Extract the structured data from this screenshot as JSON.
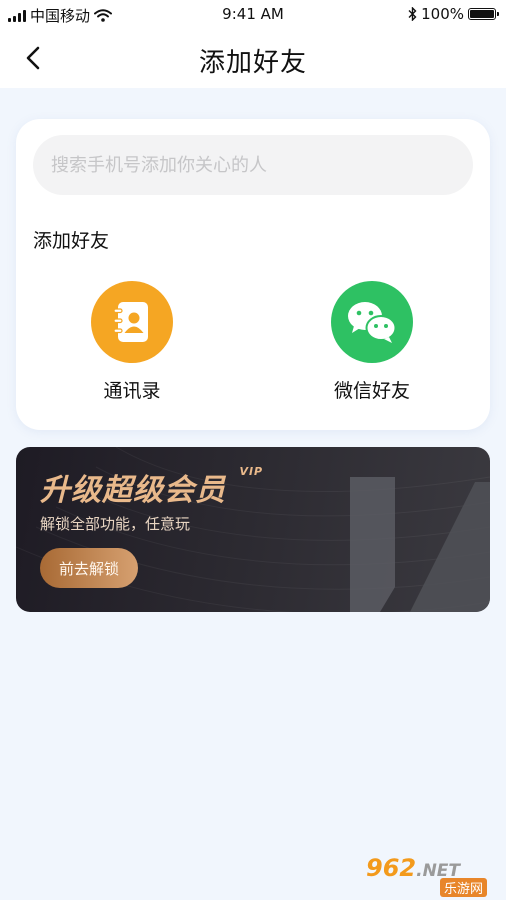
{
  "status_bar": {
    "carrier": "中国移动",
    "time": "9:41 AM",
    "battery": "100%",
    "battery_level": 1.0
  },
  "nav": {
    "title": "添加好友",
    "back_icon": "chevron-left-icon"
  },
  "search": {
    "placeholder": "搜索手机号添加你关心的人",
    "value": ""
  },
  "add_friends": {
    "section_title": "添加好友",
    "options": [
      {
        "label": "通讯录",
        "icon": "contacts-book-icon",
        "color": "#f5a623"
      },
      {
        "label": "微信好友",
        "icon": "wechat-icon",
        "color": "#2ec163"
      }
    ]
  },
  "vip": {
    "title": "升级超级会员",
    "badge": "VIP",
    "subtitle": "解锁全部功能，任意玩",
    "button": "前去解锁",
    "accent": "#e9b98b"
  },
  "watermark": {
    "number": "962",
    "suffix": ".NET",
    "caption": "乐游网"
  }
}
